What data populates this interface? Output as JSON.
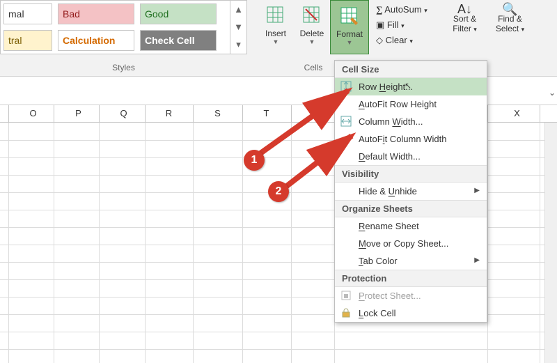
{
  "styles_gallery": {
    "row1": {
      "normal": "mal",
      "bad": "Bad",
      "good": "Good"
    },
    "row2": {
      "neutral": "tral",
      "calculation": "Calculation",
      "check_cell": "Check Cell"
    },
    "group_label": "Styles"
  },
  "cells_group": {
    "insert": "Insert",
    "delete": "Delete",
    "format": "Format",
    "group_label": "Cells"
  },
  "editing_group": {
    "autosum": "AutoSum",
    "fill": "Fill",
    "clear": "Clear"
  },
  "sort_filter": {
    "line1": "Sort &",
    "line2": "Filter"
  },
  "find_select": {
    "line1": "Find &",
    "line2": "Select"
  },
  "column_headers": [
    "O",
    "P",
    "Q",
    "R",
    "S",
    "T",
    "X"
  ],
  "format_menu": {
    "cell_size": "Cell Size",
    "row_height": "Row Height...",
    "autofit_row": "AutoFit Row Height",
    "column_width": "Column Width...",
    "autofit_col": "AutoFit Column Width",
    "default_width": "Default Width...",
    "visibility": "Visibility",
    "hide_unhide": "Hide & Unhide",
    "organize_sheets": "Organize Sheets",
    "rename_sheet": "Rename Sheet",
    "move_or_copy": "Move or Copy Sheet...",
    "tab_color": "Tab Color",
    "protection": "Protection",
    "protect_sheet": "Protect Sheet...",
    "lock_cell": "Lock Cell"
  },
  "callouts": {
    "one": "1",
    "two": "2"
  }
}
